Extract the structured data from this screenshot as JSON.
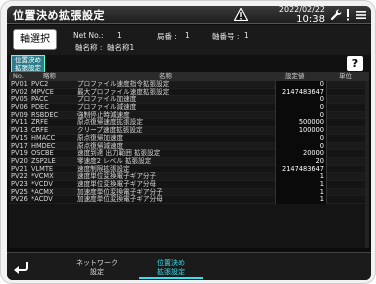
{
  "header": {
    "title": "位置決め拡張設定",
    "date": "2022/02/22",
    "time": "10:38"
  },
  "info": {
    "axis_button": "軸選択",
    "net_no_label": "Net No.:",
    "net_no": "1",
    "station_label": "局番 :",
    "station": "1",
    "axis_no_label": "軸番号 :",
    "axis_no": "1",
    "axis_name_label": "軸名称 :",
    "axis_name": "軸名称1"
  },
  "tab": {
    "active_line1": "位置決め",
    "active_line2": "拡張設定"
  },
  "help": "?",
  "table": {
    "headers": {
      "no": "No.",
      "abbr": "略称",
      "name": "名称",
      "value": "設定値",
      "unit": "単位"
    },
    "rows": [
      {
        "no": "PV01",
        "abbr": "PVC2",
        "name": "プロファイル速度指令拡張設定",
        "value": "0",
        "unit": ""
      },
      {
        "no": "PV02",
        "abbr": "MPVCE",
        "name": "最大プロファイル速度拡張設定",
        "value": "2147483647",
        "unit": ""
      },
      {
        "no": "PV05",
        "abbr": "PACC",
        "name": "プロファイル加速度",
        "value": "0",
        "unit": ""
      },
      {
        "no": "PV06",
        "abbr": "PDEC",
        "name": "プロファイル減速度",
        "value": "0",
        "unit": ""
      },
      {
        "no": "PV09",
        "abbr": "RSBDEC",
        "name": "強制停止時減速度",
        "value": "0",
        "unit": ""
      },
      {
        "no": "PV11",
        "abbr": "ZRFE",
        "name": "原点復帰速度拡張設定",
        "value": "500000",
        "unit": ""
      },
      {
        "no": "PV13",
        "abbr": "CRFE",
        "name": "クリープ速度拡張設定",
        "value": "100000",
        "unit": ""
      },
      {
        "no": "PV15",
        "abbr": "HMACC",
        "name": "原点復帰加速度",
        "value": "0",
        "unit": ""
      },
      {
        "no": "PV17",
        "abbr": "HMDEC",
        "name": "原点復帰減速度",
        "value": "0",
        "unit": ""
      },
      {
        "no": "PV19",
        "abbr": "OSCBE",
        "name": "速度到達 出力範囲 拡張設定",
        "value": "20000",
        "unit": ""
      },
      {
        "no": "PV20",
        "abbr": "ZSP2LE",
        "name": "零速度2 レベル 拡張設定",
        "value": "20",
        "unit": ""
      },
      {
        "no": "PV21",
        "abbr": "VLMTE",
        "name": "速度制限拡張設定",
        "value": "2147483647",
        "unit": ""
      },
      {
        "no": "PV22",
        "abbr": "*VCMX",
        "name": "速度単位変換電子ギア分子",
        "value": "1",
        "unit": ""
      },
      {
        "no": "PV23",
        "abbr": "*VCDV",
        "name": "速度単位変換電子ギア分母",
        "value": "1",
        "unit": ""
      },
      {
        "no": "PV25",
        "abbr": "*ACMX",
        "name": "加速度単位変換電子ギア分子",
        "value": "1",
        "unit": ""
      },
      {
        "no": "PV26",
        "abbr": "*ACDV",
        "name": "加速度単位変換電子ギア分母",
        "value": "1",
        "unit": ""
      }
    ]
  },
  "bottom": {
    "tab1_line1": "ネットワーク",
    "tab1_line2": "設定",
    "tab2_line1": "位置決め",
    "tab2_line2": "拡張設定"
  }
}
